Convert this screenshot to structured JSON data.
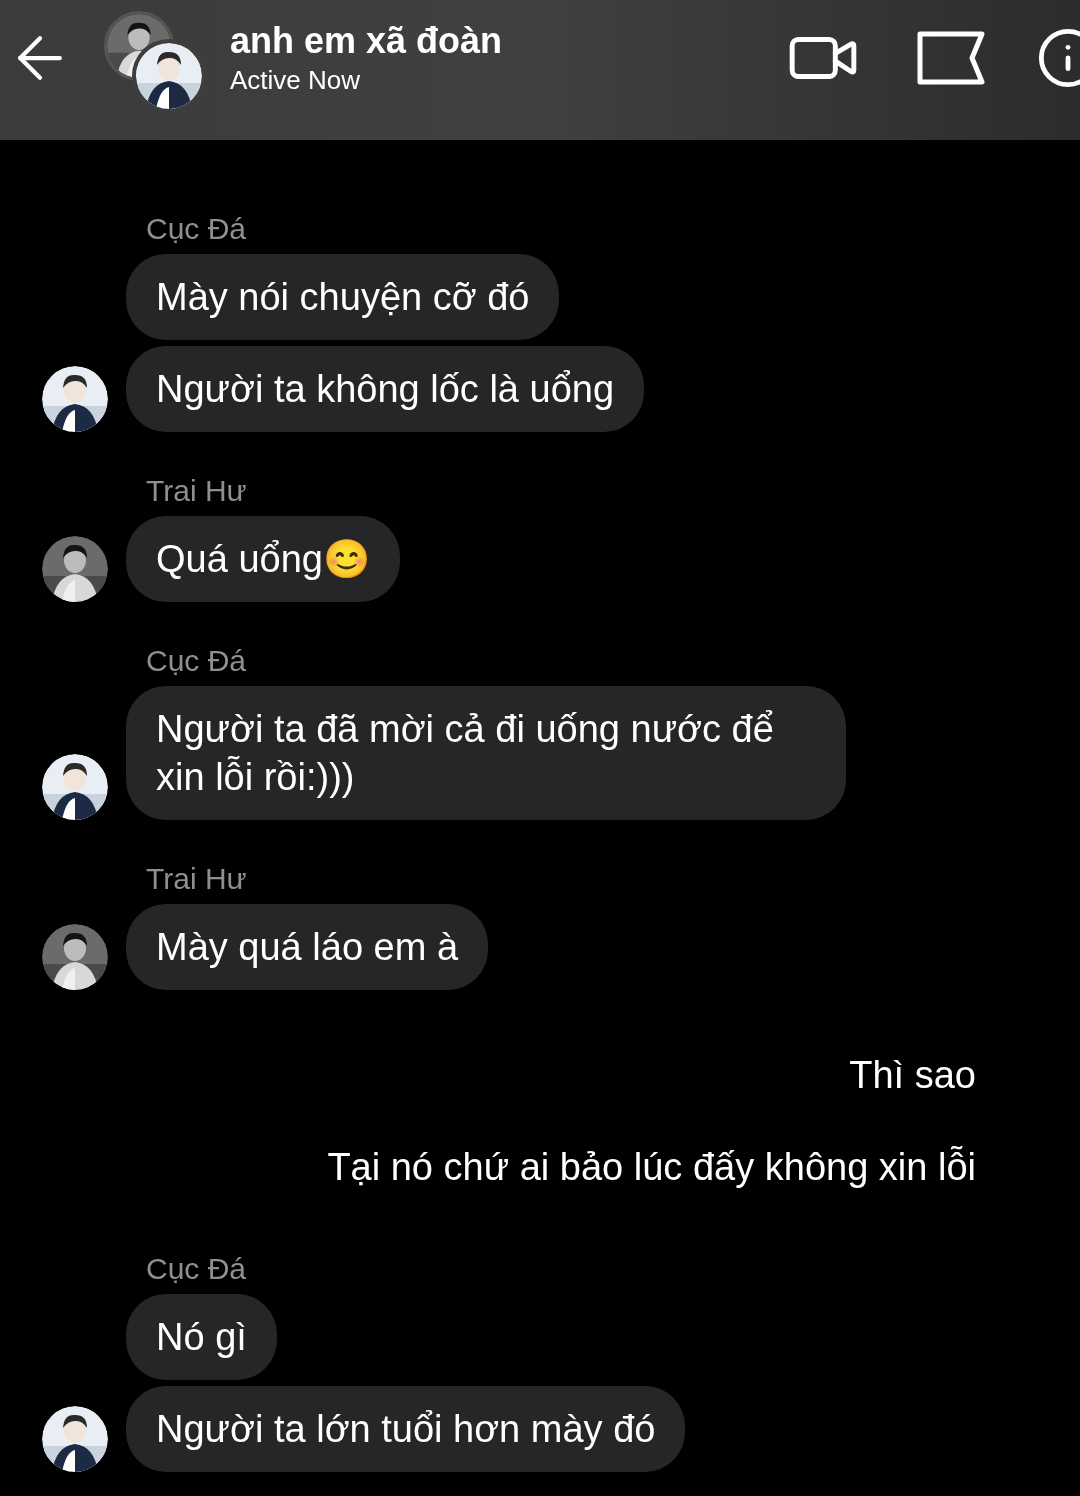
{
  "header": {
    "title": "anh em xã đoàn",
    "status": "Active Now"
  },
  "groups": [
    {
      "kind": "incoming",
      "sender": "Cục Đá",
      "messages": [
        {
          "text": "Mày nói chuyện cỡ đó",
          "avatar": false
        },
        {
          "text": "Người ta không lốc là uổng",
          "avatar": true
        }
      ]
    },
    {
      "kind": "incoming",
      "sender": "Trai Hư",
      "messages": [
        {
          "text": "Quá uổng😊",
          "avatar": true
        }
      ]
    },
    {
      "kind": "incoming",
      "sender": "Cục Đá",
      "messages": [
        {
          "text": "Người ta đã mời cả đi uống nước để xin lỗi rồi:)))",
          "avatar": true
        }
      ]
    },
    {
      "kind": "incoming",
      "sender": "Trai Hư",
      "messages": [
        {
          "text": "Mày quá láo em à",
          "avatar": true
        }
      ]
    },
    {
      "kind": "outgoing",
      "messages": [
        {
          "text": "Thì sao"
        },
        {
          "text": "Tại nó chứ ai bảo lúc đấy không xin lỗi"
        }
      ]
    },
    {
      "kind": "incoming",
      "sender": "Cục Đá",
      "messages": [
        {
          "text": "Nó gì",
          "avatar": false
        },
        {
          "text": "Người ta lớn tuổi hơn mày đó",
          "avatar": true
        }
      ]
    }
  ]
}
